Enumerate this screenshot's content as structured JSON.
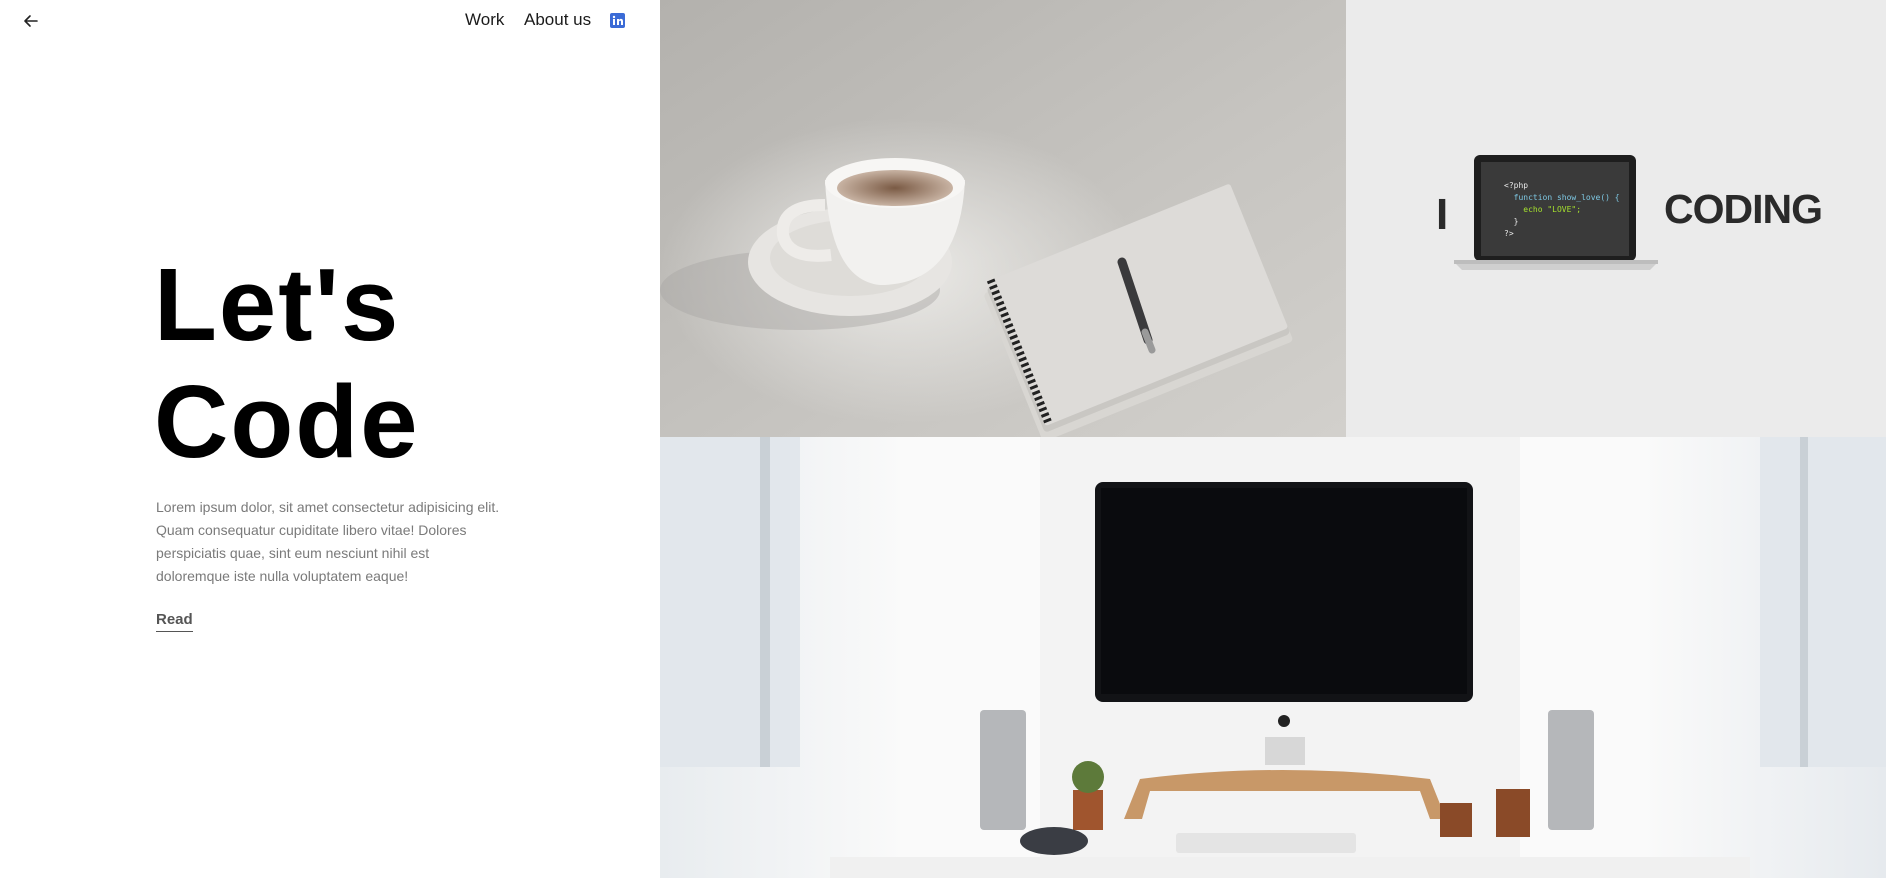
{
  "nav": {
    "back_icon": "arrow-left-icon",
    "links": [
      "Work",
      "About us"
    ],
    "social_icon": "linkedin-icon",
    "social_color": "#3b6bd6"
  },
  "hero": {
    "title_line1": "Let's",
    "title_line2": "Code",
    "body": "Lorem ipsum dolor, sit amet consectetur adipisicing elit. Quam consequatur cupiditate libero vitae! Dolores perspiciatis quae, sint eum nesciunt nihil est doloremque iste nulla voluptatem eaque!",
    "cta": "Read"
  },
  "gallery": {
    "coffee_image": "coffee-cup-notebook-pen",
    "coding_image": {
      "left_text": "I",
      "right_text": "CODING",
      "code": [
        "<?php",
        "  function show_love() {",
        "    echo \"LOVE\";",
        "  }",
        "?>"
      ]
    },
    "desk_image": "desktop-monitor-workspace"
  }
}
